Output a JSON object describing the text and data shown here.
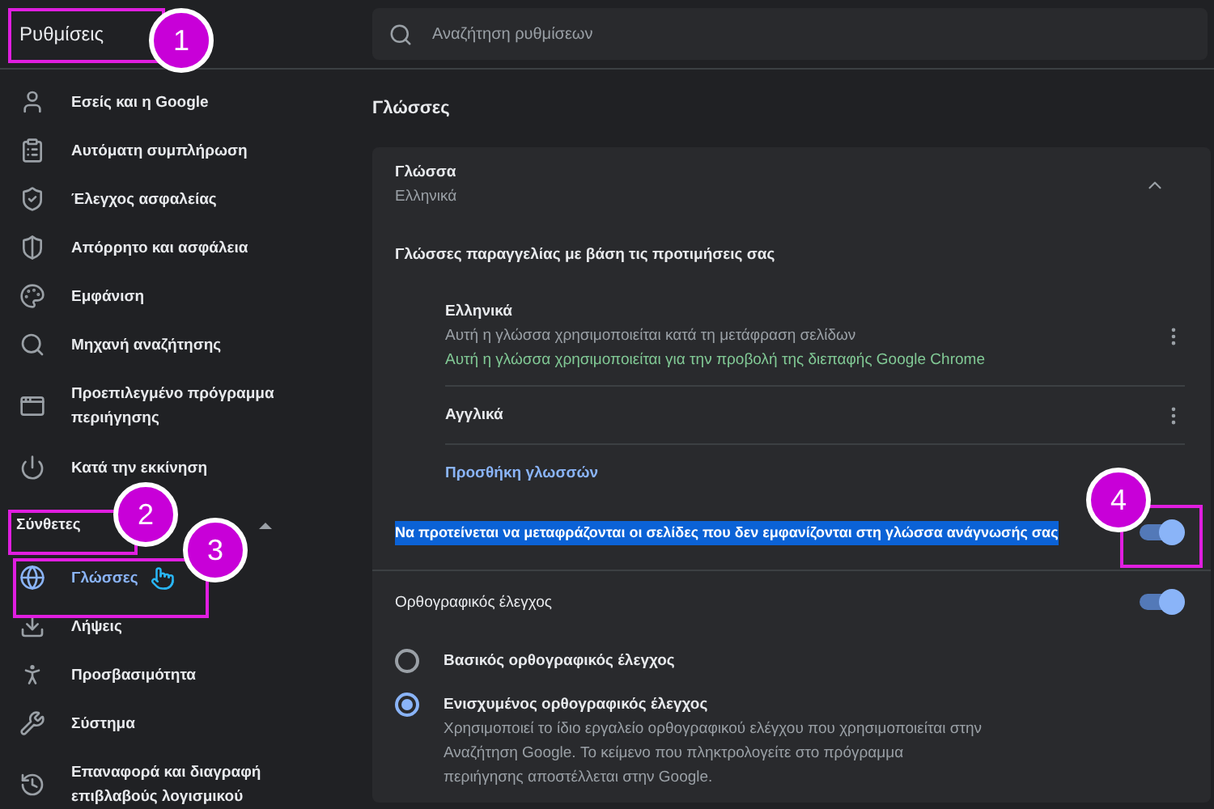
{
  "header": {
    "title": "Ρυθμίσεις",
    "search": {
      "placeholder": "Αναζήτηση ρυθμίσεων"
    }
  },
  "sidebar": {
    "items": [
      {
        "label": "Εσείς και η Google",
        "selected": false
      },
      {
        "label": "Αυτόματη συμπλήρωση",
        "selected": false
      },
      {
        "label": "Έλεγχος ασφαλείας",
        "selected": false
      },
      {
        "label": "Απόρρητο και ασφάλεια",
        "selected": false
      },
      {
        "label": "Εμφάνιση",
        "selected": false
      },
      {
        "label": "Μηχανή αναζήτησης",
        "selected": false
      },
      {
        "label": "Προεπιλεγμένο πρόγραμμα περιήγησης",
        "selected": false
      },
      {
        "label": "Κατά την εκκίνηση",
        "selected": false
      }
    ],
    "section": {
      "label": "Σύνθετες",
      "expanded": true
    },
    "advanced_items": [
      {
        "label": "Γλώσσες",
        "selected": true
      },
      {
        "label": "Λήψεις",
        "selected": false
      },
      {
        "label": "Προσβασιμότητα",
        "selected": false
      },
      {
        "label": "Σύστημα",
        "selected": false
      },
      {
        "label": "Επαναφορά και διαγραφή επιβλαβούς λογισμικού",
        "selected": false
      }
    ]
  },
  "main": {
    "heading": "Γλώσσες",
    "language": {
      "title": "Γλώσσα",
      "value": "Ελληνικά",
      "expanded": true
    },
    "order_label": "Γλώσσες παραγγελίας με βάση τις προτιμήσεις σας",
    "languages": [
      {
        "name": "Ελληνικά",
        "notes": [
          "Αυτή η γλώσσα χρησιμοποιείται κατά τη μετάφραση σελίδων"
        ],
        "ui_note": "Αυτή η γλώσσα χρησιμοποιείται για την προβολή της διεπαφής Google Chrome"
      },
      {
        "name": "Αγγλικά"
      }
    ],
    "add_link": "Προσθήκη γλωσσών",
    "translate": {
      "label": "Να προτείνεται να μεταφράζονται οι σελίδες που δεν εμφανίζονται στη γλώσσα ανάγνωσής σας",
      "highlighted": true,
      "on": true
    },
    "spellcheck": {
      "label": "Ορθογραφικός έλεγχος",
      "on": true
    },
    "spell_options": [
      {
        "label": "Βασικός ορθογραφικός έλεγχος",
        "selected": false
      },
      {
        "label": "Ενισχυμένος ορθογραφικός έλεγχος",
        "selected": true,
        "description": "Χρησιμοποιεί το ίδιο εργαλείο ορθογραφικού ελέγχου που χρησιμοποιείται στην Αναζήτηση Google. Το κείμενο που πληκτρολογείτε στο πρόγραμμα περιήγησης αποστέλλεται στην Google."
      }
    ]
  },
  "annotations": [
    {
      "number": "1"
    },
    {
      "number": "2"
    },
    {
      "number": "3"
    },
    {
      "number": "4"
    }
  ]
}
